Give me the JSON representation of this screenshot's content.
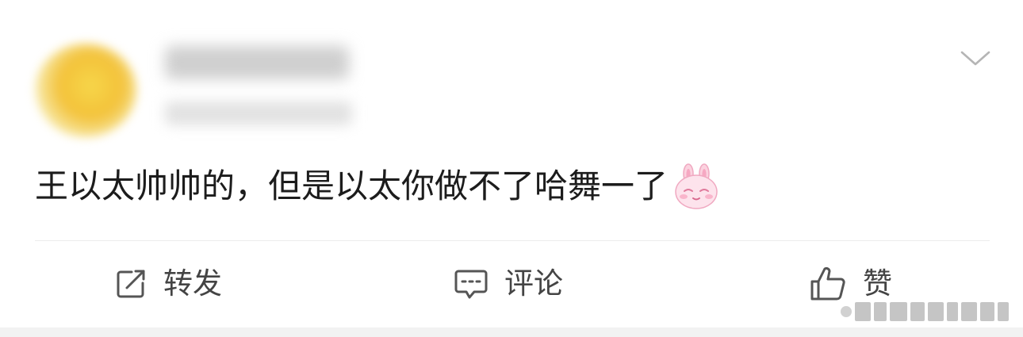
{
  "post": {
    "author": {
      "name": "",
      "meta": ""
    },
    "text": "王以太帅帅的，但是以太你做不了哈舞一了",
    "emoji": "rabbit-blush-emoji"
  },
  "actions": [
    {
      "label": "转发",
      "icon": "repost-icon"
    },
    {
      "label": "评论",
      "icon": "comment-icon"
    },
    {
      "label": "赞",
      "icon": "thumbs-up-icon"
    }
  ],
  "colors": {
    "text": "#1c1c1c",
    "action_text": "#444444",
    "icon": "#555555",
    "divider": "#ececec",
    "bottom_strip": "#f2f2f2"
  }
}
